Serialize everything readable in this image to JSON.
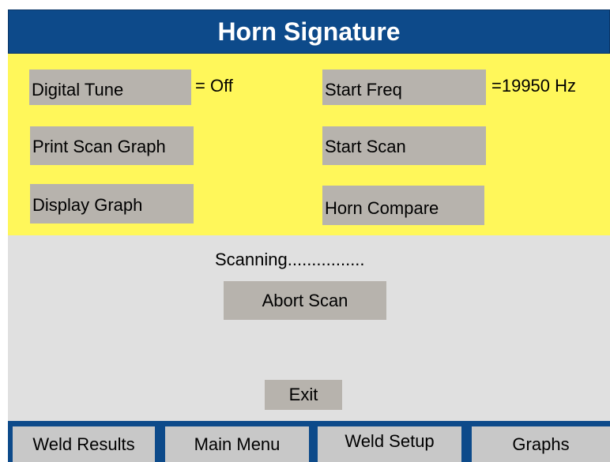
{
  "title": "Horn Signature",
  "colors": {
    "title_bar": "#0d4a8a",
    "title_text": "#ffffff",
    "settings_panel": "#fff75a",
    "status_panel": "#e0e0e0",
    "button": "#b7b3ad",
    "nav_button": "#c8c8c8"
  },
  "settings": {
    "digital_tune_label": "Digital Tune",
    "digital_tune_value": "= Off",
    "start_freq_label": "Start Freq",
    "start_freq_value": "=19950 Hz",
    "print_scan_graph_label": "Print Scan Graph",
    "start_scan_label": "Start Scan",
    "display_graph_label": "Display Graph",
    "horn_compare_label": "Horn Compare"
  },
  "status": {
    "message": "Scanning................",
    "abort_label": "Abort Scan",
    "exit_label": "Exit"
  },
  "nav": {
    "items": [
      {
        "label": "Weld Results"
      },
      {
        "label": "Main Menu"
      },
      {
        "label": "Weld Setup"
      },
      {
        "label": "Graphs"
      }
    ]
  }
}
